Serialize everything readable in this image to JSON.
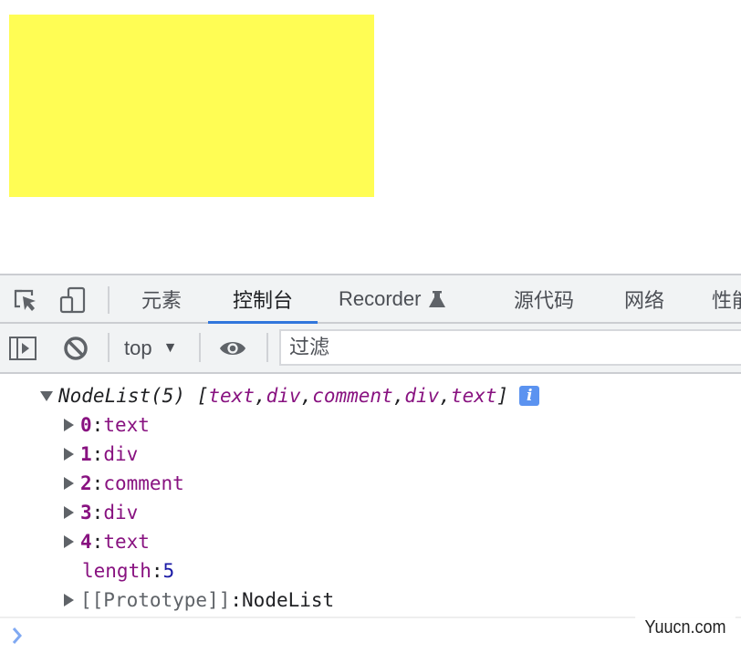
{
  "page": {
    "box_color": "#fffd54"
  },
  "devtools": {
    "tabs": [
      {
        "label": "元素",
        "active": false
      },
      {
        "label": "控制台",
        "active": true
      },
      {
        "label": "Recorder",
        "active": false,
        "icon": "flask-icon"
      },
      {
        "label": "源代码",
        "active": false
      },
      {
        "label": "网络",
        "active": false
      },
      {
        "label": "性能",
        "active": false
      }
    ],
    "accent_color": "#3176dc",
    "toolbar": {
      "context": "top",
      "filter_placeholder": "过滤"
    }
  },
  "console": {
    "header": {
      "prefix": "NodeList(5) [",
      "items": [
        "text",
        "div",
        "comment",
        "div",
        "text"
      ],
      "sep": ", ",
      "suffix": "]",
      "info_icon": "i"
    },
    "entries": [
      {
        "key": "0",
        "value": "text"
      },
      {
        "key": "1",
        "value": "div"
      },
      {
        "key": "2",
        "value": "comment"
      },
      {
        "key": "3",
        "value": "div"
      },
      {
        "key": "4",
        "value": "text"
      }
    ],
    "length": {
      "key": "length",
      "value": "5"
    },
    "prototype": {
      "key": "[[Prototype]]",
      "value": "NodeList"
    },
    "colon": ": "
  },
  "watermark": "Yuucn.com"
}
